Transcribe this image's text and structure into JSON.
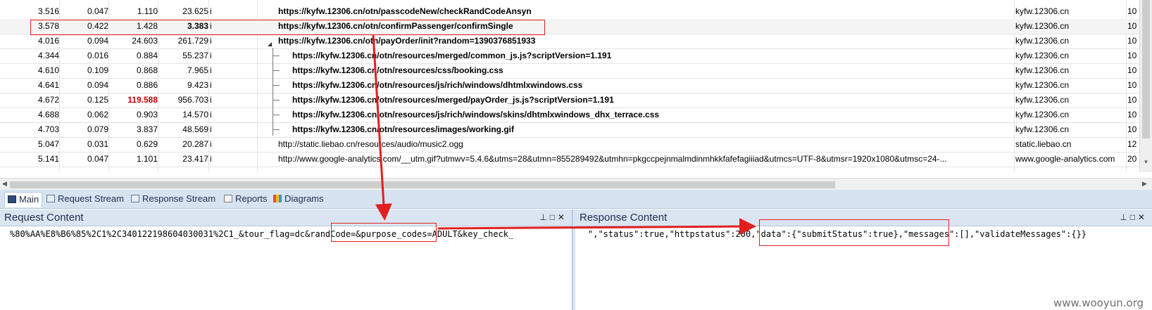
{
  "rows": [
    {
      "c1": "3.516",
      "c2": "0.047",
      "c3": "1.110",
      "c4": "23.625",
      "icon": "i",
      "url": "https://kyfw.12306.cn/otn/passcodeNew/checkRandCodeAnsyn",
      "host": "kyfw.12306.cn",
      "extra": "10",
      "bold": true
    },
    {
      "c1": "3.578",
      "c2": "0.422",
      "c3": "1.428",
      "c4": "3.383",
      "icon": "i",
      "url": "https://kyfw.12306.cn/otn/confirmPassenger/confirmSingle",
      "host": "kyfw.12306.cn",
      "extra": "10",
      "bold": true
    },
    {
      "c1": "4.016",
      "c2": "0.094",
      "c3": "24.603",
      "c4": "261.729",
      "icon": "i",
      "url": "https://kyfw.12306.cn/otn/payOrder/init?random=1390376851933",
      "host": "kyfw.12306.cn",
      "extra": "10",
      "bold": true
    },
    {
      "c1": "4.344",
      "c2": "0.016",
      "c3": "0.884",
      "c4": "55.237",
      "icon": "i",
      "url": "https://kyfw.12306.cn/otn/resources/merged/common_js.js?scriptVersion=1.191",
      "host": "kyfw.12306.cn",
      "extra": "10",
      "bold": true
    },
    {
      "c1": "4.610",
      "c2": "0.109",
      "c3": "0.868",
      "c4": "7.965",
      "icon": "i",
      "url": "https://kyfw.12306.cn/otn/resources/css/booking.css",
      "host": "kyfw.12306.cn",
      "extra": "10",
      "bold": true
    },
    {
      "c1": "4.641",
      "c2": "0.094",
      "c3": "0.886",
      "c4": "9.423",
      "icon": "i",
      "url": "https://kyfw.12306.cn/otn/resources/js/rich/windows/dhtmlxwindows.css",
      "host": "kyfw.12306.cn",
      "extra": "10",
      "bold": true
    },
    {
      "c1": "4.672",
      "c2": "0.125",
      "c3": "119.588",
      "c4": "956.703",
      "icon": "i",
      "url": "https://kyfw.12306.cn/otn/resources/merged/payOrder_js.js?scriptVersion=1.191",
      "host": "kyfw.12306.cn",
      "extra": "10",
      "bold": true
    },
    {
      "c1": "4.688",
      "c2": "0.062",
      "c3": "0.903",
      "c4": "14.570",
      "icon": "i",
      "url": "https://kyfw.12306.cn/otn/resources/js/rich/windows/skins/dhtmlxwindows_dhx_terrace.css",
      "host": "kyfw.12306.cn",
      "extra": "10",
      "bold": true
    },
    {
      "c1": "4.703",
      "c2": "0.079",
      "c3": "3.837",
      "c4": "48.569",
      "icon": "i",
      "url": "https://kyfw.12306.cn/otn/resources/images/working.gif",
      "host": "kyfw.12306.cn",
      "extra": "10",
      "bold": true
    },
    {
      "c1": "5.047",
      "c2": "0.031",
      "c3": "0.629",
      "c4": "20.287",
      "icon": "i",
      "url": "http://static.liebao.cn/resources/audio/music2.ogg",
      "host": "static.liebao.cn",
      "extra": "12",
      "bold": false
    },
    {
      "c1": "5.141",
      "c2": "0.047",
      "c3": "1.101",
      "c4": "23.417",
      "icon": "i",
      "url": "http://www.google-analytics.com/__utm.gif?utmwv=5.4.6&utms=28&utmn=855289492&utmhn=pkgccpejnmalmdinmhkkfafefagiiiad&utmcs=UTF-8&utmsr=1920x1080&utmsc=24-...",
      "host": "www.google-analytics.com",
      "extra": "20",
      "bold": false
    }
  ],
  "tabs": {
    "main": "Main",
    "request_stream": "Request Stream",
    "response_stream": "Response Stream",
    "reports": "Reports",
    "diagrams": "Diagrams"
  },
  "request_panel": {
    "title": "Request Content",
    "body": "%80%AA%E8%B6%85%2C1%2C340122198604030031%2C1_&tour_flag=dc&randCode=&purpose_codes=ADULT&key_check_"
  },
  "response_panel": {
    "title": "Response Content",
    "body": "\",\"status\":true,\"httpstatus\":200,\"data\":{\"submitStatus\":true},\"messages\":[],\"validateMessages\":{}}"
  },
  "panel_buttons": "⊥□✕",
  "watermark": "www.wooyun.org",
  "colors": {
    "annotation_red": "#e02020",
    "slow_value_red": "#c00000",
    "tab_strip": "#d8e3f1"
  }
}
